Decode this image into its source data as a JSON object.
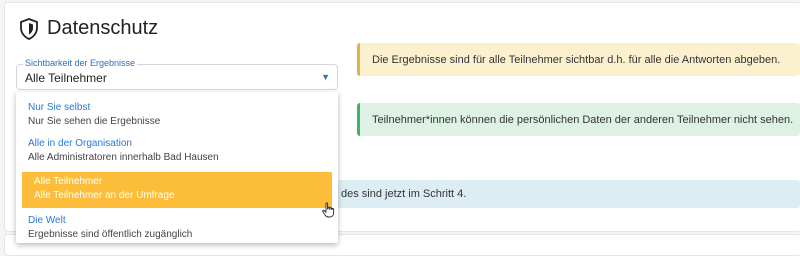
{
  "section": {
    "title": "Datenschutz",
    "icon": "shield-icon"
  },
  "visibility_select": {
    "legend": "Sichtbarkeit der Ergebnisse",
    "value": "Alle Teilnehmer",
    "caret": "▼",
    "options": [
      {
        "label": "Nur Sie selbst",
        "description": "Nur Sie sehen die Ergebnisse",
        "selected": false
      },
      {
        "label": "Alle in der Organisation",
        "description": "Alle Administratoren innerhalb Bad Hausen",
        "selected": false
      },
      {
        "label": "Alle Teilnehmer",
        "description": "Alle Teilnehmer an der Umfrage",
        "selected": true
      },
      {
        "label": "Die Welt",
        "description": "Ergebnisse sind öffentlich zugänglich",
        "selected": false
      }
    ]
  },
  "alerts": {
    "results_visibility": "Die Ergebnisse sind für alle Teilnehmer sichtbar d.h. für alle die Antworten abgeben.",
    "personal_data": "Teilnehmer*innen können die persönlichen Daten der anderen Teilnehmer nicht sehen.",
    "step_info": "des sind jetzt im Schritt 4."
  },
  "colors": {
    "accent": "#2a78d6",
    "highlight": "#fbbd3a",
    "warning_bg": "#fcf1cf",
    "success_bg": "#ddf2e4",
    "info_bg": "#dcedf4"
  }
}
